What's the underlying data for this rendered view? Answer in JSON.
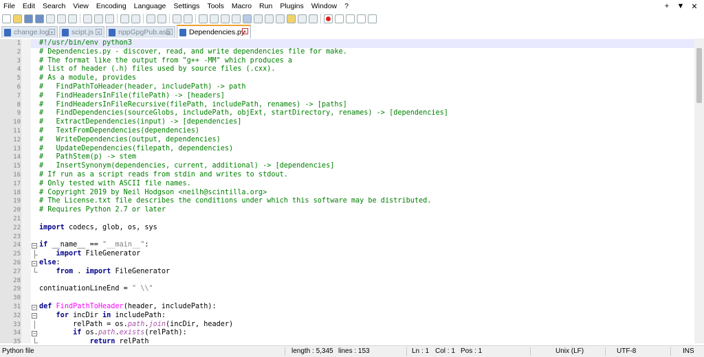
{
  "menu": [
    "File",
    "Edit",
    "Search",
    "View",
    "Encoding",
    "Language",
    "Settings",
    "Tools",
    "Macro",
    "Run",
    "Plugins",
    "Window",
    "?"
  ],
  "window_controls": {
    "add": "+",
    "dropdown": "▼",
    "close": "✕"
  },
  "tabs": [
    {
      "label": "change.log",
      "active": false
    },
    {
      "label": "scipt.js",
      "active": false
    },
    {
      "label": "nppGpgPub.asc",
      "active": false
    },
    {
      "label": "Dependencies.py",
      "active": true
    }
  ],
  "editor": {
    "current_line": 1,
    "lines": [
      {
        "n": "1",
        "segs": [
          {
            "t": "#!/usr/bin/env python3",
            "c": "comment"
          }
        ]
      },
      {
        "n": "2",
        "segs": [
          {
            "t": "# Dependencies.py - discover, read, and write dependencies file for make.",
            "c": "comment"
          }
        ]
      },
      {
        "n": "3",
        "segs": [
          {
            "t": "# The format like the output from \"g++ -MM\" which produces a",
            "c": "comment"
          }
        ]
      },
      {
        "n": "4",
        "segs": [
          {
            "t": "# list of header (.h) files used by source files (.cxx).",
            "c": "comment"
          }
        ]
      },
      {
        "n": "5",
        "segs": [
          {
            "t": "# As a module, provides",
            "c": "comment"
          }
        ]
      },
      {
        "n": "6",
        "segs": [
          {
            "t": "#   FindPathToHeader(header, includePath) -> path",
            "c": "comment"
          }
        ]
      },
      {
        "n": "7",
        "segs": [
          {
            "t": "#   FindHeadersInFile(filePath) -> [headers]",
            "c": "comment"
          }
        ]
      },
      {
        "n": "8",
        "segs": [
          {
            "t": "#   FindHeadersInFileRecursive(filePath, includePath, renames) -> [paths]",
            "c": "comment"
          }
        ]
      },
      {
        "n": "9",
        "segs": [
          {
            "t": "#   FindDependencies(sourceGlobs, includePath, objExt, startDirectory, renames) -> [dependencies]",
            "c": "comment"
          }
        ]
      },
      {
        "n": "10",
        "segs": [
          {
            "t": "#   ExtractDependencies(input) -> [dependencies]",
            "c": "comment"
          }
        ]
      },
      {
        "n": "11",
        "segs": [
          {
            "t": "#   TextFromDependencies(dependencies)",
            "c": "comment"
          }
        ]
      },
      {
        "n": "12",
        "segs": [
          {
            "t": "#   WriteDependencies(output, dependencies)",
            "c": "comment"
          }
        ]
      },
      {
        "n": "13",
        "segs": [
          {
            "t": "#   UpdateDependencies(filepath, dependencies)",
            "c": "comment"
          }
        ]
      },
      {
        "n": "14",
        "segs": [
          {
            "t": "#   PathStem(p) -> stem",
            "c": "comment"
          }
        ]
      },
      {
        "n": "15",
        "segs": [
          {
            "t": "#   InsertSynonym(dependencies, current, additional) -> [dependencies]",
            "c": "comment"
          }
        ]
      },
      {
        "n": "16",
        "segs": [
          {
            "t": "# If run as a script reads from stdin and writes to stdout.",
            "c": "comment"
          }
        ]
      },
      {
        "n": "17",
        "segs": [
          {
            "t": "# Only tested with ASCII file names.",
            "c": "comment"
          }
        ]
      },
      {
        "n": "18",
        "segs": [
          {
            "t": "# Copyright 2019 by Neil Hodgson <neilh@scintilla.org>",
            "c": "comment"
          }
        ]
      },
      {
        "n": "19",
        "segs": [
          {
            "t": "# The License.txt file describes the conditions under which this software may be distributed.",
            "c": "comment"
          }
        ]
      },
      {
        "n": "20",
        "segs": [
          {
            "t": "# Requires Python 2.7 or later",
            "c": "comment"
          }
        ]
      },
      {
        "n": "21",
        "segs": []
      },
      {
        "n": "22",
        "segs": [
          {
            "t": "import",
            "c": "kw"
          },
          {
            "t": " codecs, glob, os, sys",
            "c": "dec"
          }
        ]
      },
      {
        "n": "23",
        "segs": []
      },
      {
        "n": "24",
        "segs": [
          {
            "t": "if",
            "c": "kw"
          },
          {
            "t": " __name__ == ",
            "c": "dec"
          },
          {
            "t": "\"__main__\"",
            "c": "str"
          },
          {
            "t": ":",
            "c": "dec"
          }
        ]
      },
      {
        "n": "25",
        "segs": [
          {
            "t": "    ",
            "c": "dec"
          },
          {
            "t": "import",
            "c": "kw"
          },
          {
            "t": " FileGenerator",
            "c": "dec"
          }
        ]
      },
      {
        "n": "26",
        "segs": [
          {
            "t": "else",
            "c": "kw"
          },
          {
            "t": ":",
            "c": "dec"
          }
        ]
      },
      {
        "n": "27",
        "segs": [
          {
            "t": "    ",
            "c": "dec"
          },
          {
            "t": "from",
            "c": "kw"
          },
          {
            "t": " . ",
            "c": "dec"
          },
          {
            "t": "import",
            "c": "kw"
          },
          {
            "t": " FileGenerator",
            "c": "dec"
          }
        ]
      },
      {
        "n": "28",
        "segs": []
      },
      {
        "n": "29",
        "segs": [
          {
            "t": "continuationLineEnd = ",
            "c": "dec"
          },
          {
            "t": "\" \\\\\"",
            "c": "str"
          }
        ]
      },
      {
        "n": "30",
        "segs": []
      },
      {
        "n": "31",
        "segs": [
          {
            "t": "def",
            "c": "kw"
          },
          {
            "t": " ",
            "c": "dec"
          },
          {
            "t": "FindPathToHeader",
            "c": "fn"
          },
          {
            "t": "(header, includePath):",
            "c": "dec"
          }
        ]
      },
      {
        "n": "32",
        "segs": [
          {
            "t": "    ",
            "c": "dec"
          },
          {
            "t": "for",
            "c": "kw"
          },
          {
            "t": " incDir ",
            "c": "dec"
          },
          {
            "t": "in",
            "c": "kw"
          },
          {
            "t": " includePath:",
            "c": "dec"
          }
        ]
      },
      {
        "n": "33",
        "segs": [
          {
            "t": "        relPath = os.",
            "c": "dec"
          },
          {
            "t": "path",
            "c": "attr"
          },
          {
            "t": ".",
            "c": "dec"
          },
          {
            "t": "join",
            "c": "attr"
          },
          {
            "t": "(incDir, header)",
            "c": "dec"
          }
        ]
      },
      {
        "n": "34",
        "segs": [
          {
            "t": "        ",
            "c": "dec"
          },
          {
            "t": "if",
            "c": "kw"
          },
          {
            "t": " os.",
            "c": "dec"
          },
          {
            "t": "path",
            "c": "attr"
          },
          {
            "t": ".",
            "c": "dec"
          },
          {
            "t": "exists",
            "c": "attr"
          },
          {
            "t": "(relPath):",
            "c": "dec"
          }
        ]
      },
      {
        "n": "35",
        "segs": [
          {
            "t": "            ",
            "c": "dec"
          },
          {
            "t": "return",
            "c": "kw"
          },
          {
            "t": " relPath",
            "c": "dec"
          }
        ]
      }
    ]
  },
  "status": {
    "file_type": "Python file",
    "length": "length : 5,345",
    "lines": "lines : 153",
    "ln": "Ln : 1",
    "col": "Col : 1",
    "pos": "Pos : 1",
    "eol": "Unix (LF)",
    "encoding": "UTF-8",
    "mode": "INS"
  }
}
